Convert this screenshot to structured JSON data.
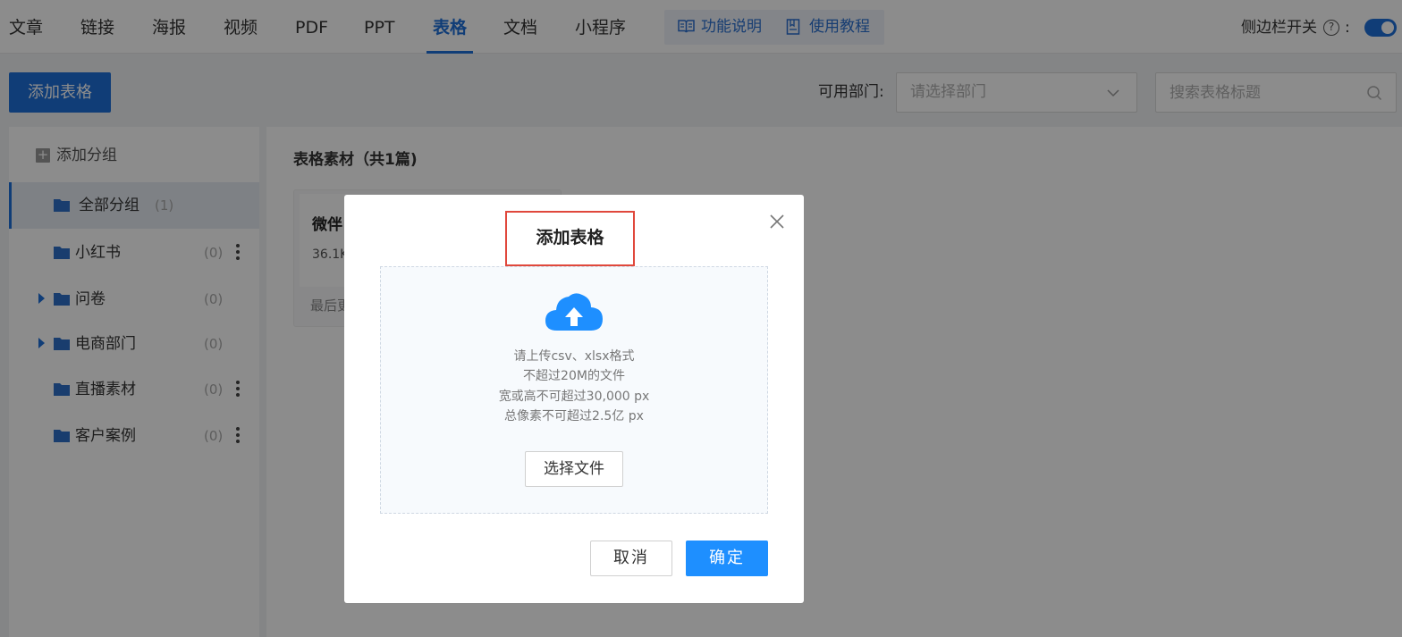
{
  "nav": {
    "tabs": [
      {
        "label": "文章"
      },
      {
        "label": "链接"
      },
      {
        "label": "海报"
      },
      {
        "label": "视频"
      },
      {
        "label": "PDF"
      },
      {
        "label": "PPT"
      },
      {
        "label": "表格",
        "active": true
      },
      {
        "label": "文档"
      },
      {
        "label": "小程序"
      }
    ],
    "help": {
      "feature_desc": "功能说明",
      "tutorial": "使用教程"
    },
    "sidebar_toggle_label": "侧边栏开关",
    "sidebar_toggle_on": true
  },
  "toolbar": {
    "add_button": "添加表格",
    "dept_label": "可用部门:",
    "dept_placeholder": "请选择部门",
    "search_placeholder": "搜索表格标题"
  },
  "groups": {
    "add_group": "添加分组",
    "items": [
      {
        "name": "全部分组",
        "count": "(1)",
        "active": true
      },
      {
        "name": "小红书",
        "count": "(0)",
        "has_menu": true
      },
      {
        "name": "问卷",
        "count": "(0)",
        "expandable": true
      },
      {
        "name": "电商部门",
        "count": "(0)",
        "expandable": true
      },
      {
        "name": "直播素材",
        "count": "(0)",
        "has_menu": true
      },
      {
        "name": "客户案例",
        "count": "(0)",
        "has_menu": true
      }
    ]
  },
  "main": {
    "title": "表格素材（共1篇)",
    "card": {
      "title": "微伴",
      "size": "36.1K",
      "updated": "最后更"
    }
  },
  "modal": {
    "title": "添加表格",
    "hints": [
      "请上传csv、xlsx格式",
      "不超过20M的文件",
      "宽或高不可超过30,000 px",
      "总像素不可超过2.5亿 px"
    ],
    "choose_file": "选择文件",
    "cancel": "取消",
    "confirm": "确定"
  },
  "colors": {
    "primary": "#1e6fd9",
    "confirm": "#1e8fff",
    "highlight_border": "#e0483c"
  }
}
